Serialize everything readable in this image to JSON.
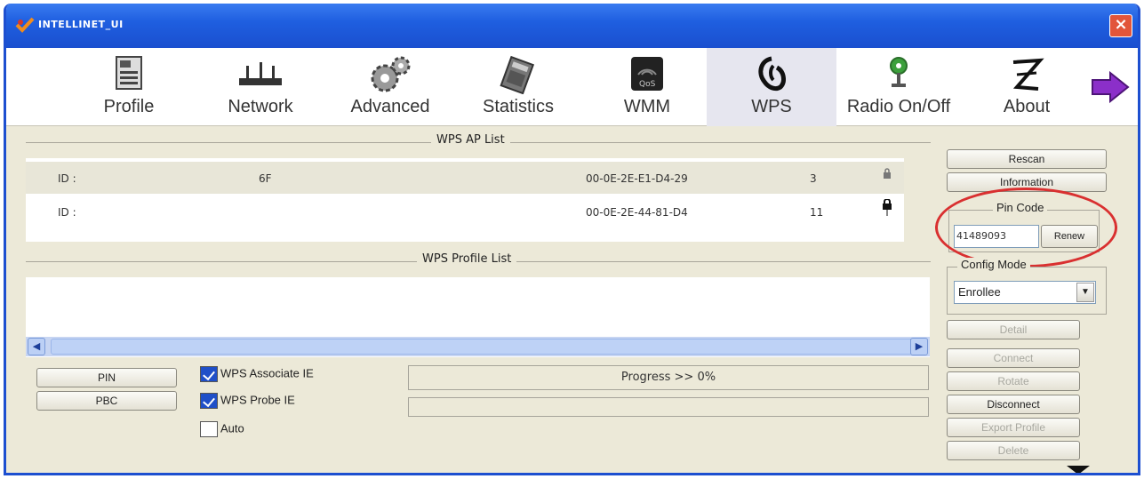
{
  "window": {
    "title": "INTELLINET_UI",
    "close_label": "×"
  },
  "toolbar": {
    "items": [
      {
        "label": "Profile",
        "icon": "profile-icon"
      },
      {
        "label": "Network",
        "icon": "network-icon"
      },
      {
        "label": "Advanced",
        "icon": "gears-icon"
      },
      {
        "label": "Statistics",
        "icon": "statistics-icon"
      },
      {
        "label": "WMM",
        "icon": "qos-icon"
      },
      {
        "label": "WPS",
        "icon": "wps-icon",
        "active": true
      },
      {
        "label": "Radio On/Off",
        "icon": "radio-icon"
      },
      {
        "label": "About",
        "icon": "about-icon"
      }
    ],
    "next_icon": "arrow-right-icon"
  },
  "ap_list": {
    "title": "WPS AP List",
    "rows": [
      {
        "id": "ID :",
        "ssid": "6F",
        "bssid": "00-0E-2E-E1-D4-29",
        "channel": "3"
      },
      {
        "id": "ID :",
        "ssid": "",
        "bssid": "00-0E-2E-44-81-D4",
        "channel": "11"
      }
    ]
  },
  "profile_list": {
    "title": "WPS Profile List"
  },
  "buttons": {
    "pin": "PIN",
    "pbc": "PBC",
    "rescan": "Rescan",
    "information": "Information",
    "renew": "Renew",
    "detail": "Detail",
    "connect": "Connect",
    "rotate": "Rotate",
    "disconnect": "Disconnect",
    "export_profile": "Export Profile",
    "delete": "Delete"
  },
  "checkboxes": {
    "associate_ie": {
      "label": "WPS Associate IE",
      "checked": true
    },
    "probe_ie": {
      "label": "WPS Probe IE",
      "checked": true
    },
    "auto": {
      "label": "Auto",
      "checked": false
    }
  },
  "progress": {
    "text": "Progress >> 0%"
  },
  "pin_code": {
    "title": "Pin Code",
    "value": "41489093"
  },
  "config_mode": {
    "title": "Config Mode",
    "selected": "Enrollee"
  },
  "colors": {
    "titlebar": "#1f5fe0",
    "highlight": "#d93030",
    "window_bg": "#ece9d8"
  }
}
